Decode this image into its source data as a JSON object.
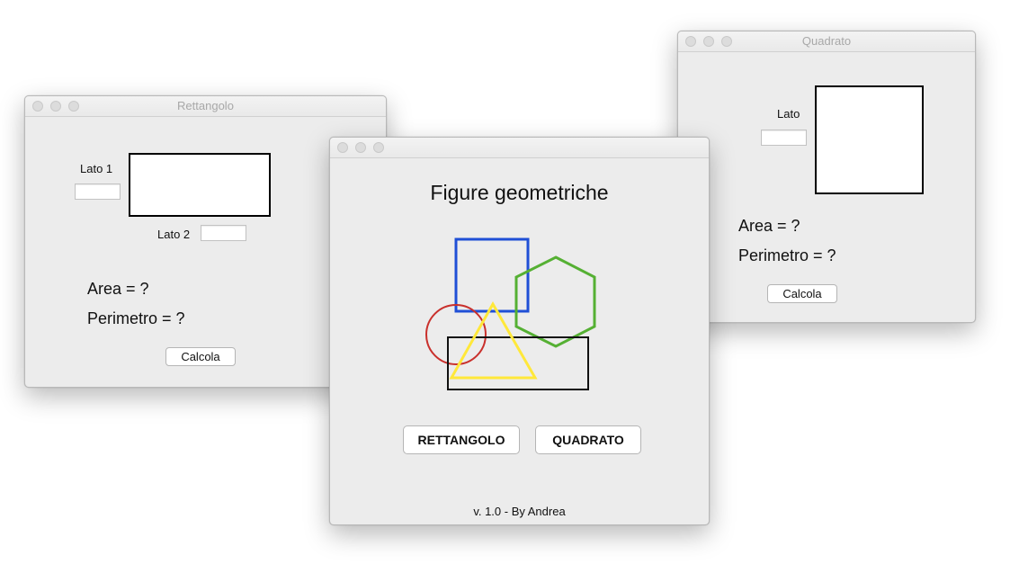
{
  "windows": {
    "rettangolo": {
      "title": "Rettangolo",
      "lato1_label": "Lato 1",
      "lato1_value": "",
      "lato2_label": "Lato 2",
      "lato2_value": "",
      "area_text": "Area = ?",
      "perimetro_text": "Perimetro = ?",
      "calcola_label": "Calcola"
    },
    "main": {
      "title": "",
      "heading": "Figure geometriche",
      "rettangolo_button": "RETTANGOLO",
      "quadrato_button": "QUADRATO",
      "footer": "v. 1.0 - By Andrea"
    },
    "quadrato": {
      "title": "Quadrato",
      "lato_label": "Lato",
      "lato_value": "",
      "area_text": "Area = ?",
      "perimetro_text": "Perimetro = ?",
      "calcola_label": "Calcola"
    }
  },
  "logo_colors": {
    "square": "#1f4fd6",
    "hexagon": "#55b033",
    "circle": "#c9302c",
    "triangle": "#ffe83a",
    "rectangle": "#111111"
  }
}
